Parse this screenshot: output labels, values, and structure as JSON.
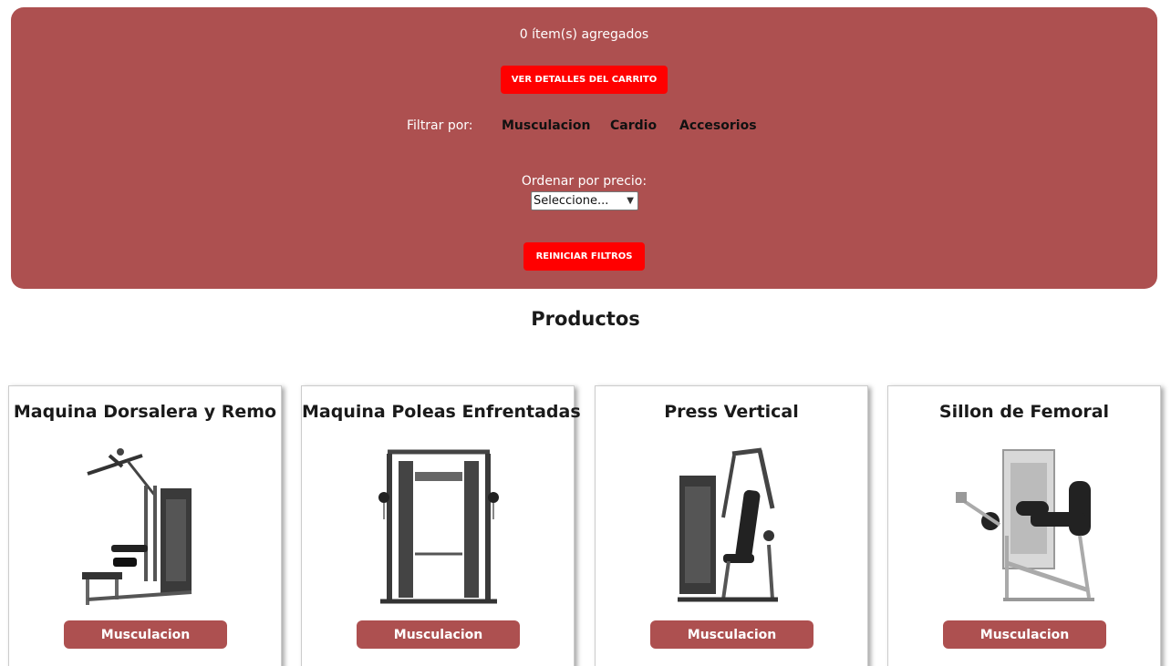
{
  "cart": {
    "count_text": "0 ítem(s) agregados",
    "details_button": "VER DETALLES DEL CARRITO"
  },
  "filters": {
    "label": "Filtrar por:",
    "options": [
      "Musculacion",
      "Cardio",
      "Accesorios"
    ]
  },
  "sort": {
    "label": "Ordenar por precio:",
    "selected": "Seleccione..."
  },
  "reset_button": "REINICIAR FILTROS",
  "products": {
    "title": "Productos",
    "items": [
      {
        "name": "Maquina Dorsalera y Remo",
        "category": "Musculacion",
        "image": "lat-pulldown-row-machine"
      },
      {
        "name": "Maquina Poleas Enfrentadas",
        "category": "Musculacion",
        "image": "functional-trainer-cable-crossover"
      },
      {
        "name": "Press Vertical",
        "category": "Musculacion",
        "image": "vertical-chest-press-machine"
      },
      {
        "name": "Sillon de Femoral",
        "category": "Musculacion",
        "image": "leg-curl-machine"
      }
    ]
  },
  "colors": {
    "panel": "#ad5050",
    "primary_button": "#ff0000",
    "category_button": "#ad5050"
  }
}
